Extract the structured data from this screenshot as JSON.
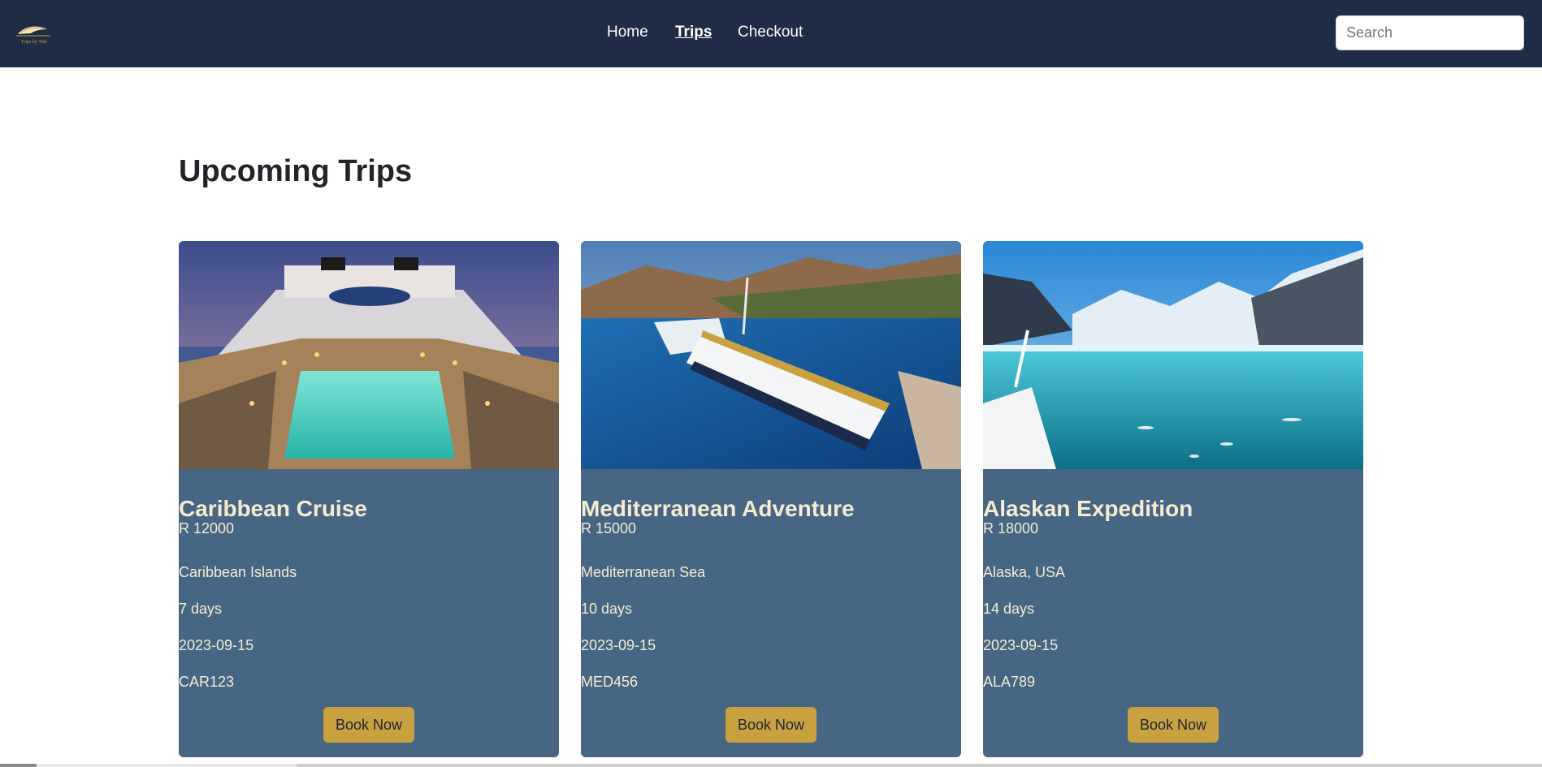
{
  "brand": {
    "logo_text": "Trips by Tide"
  },
  "nav": {
    "home": "Home",
    "trips": "Trips",
    "checkout": "Checkout"
  },
  "search": {
    "placeholder": "Search"
  },
  "page": {
    "title": "Upcoming Trips"
  },
  "colors": {
    "navbar": "#1f2c45",
    "card": "#476684",
    "accent": "#c9a23f",
    "card_text": "#f5ecd0"
  },
  "trips": [
    {
      "title": "Caribbean Cruise",
      "price": "R 12000",
      "destination": "Caribbean Islands",
      "duration": "7 days",
      "date": "2023-09-15",
      "code": "CAR123",
      "button": "Book Now"
    },
    {
      "title": "Mediterranean Adventure",
      "price": "R 15000",
      "destination": "Mediterranean Sea",
      "duration": "10 days",
      "date": "2023-09-15",
      "code": "MED456",
      "button": "Book Now"
    },
    {
      "title": "Alaskan Expedition",
      "price": "R 18000",
      "destination": "Alaska, USA",
      "duration": "14 days",
      "date": "2023-09-15",
      "code": "ALA789",
      "button": "Book Now"
    }
  ]
}
